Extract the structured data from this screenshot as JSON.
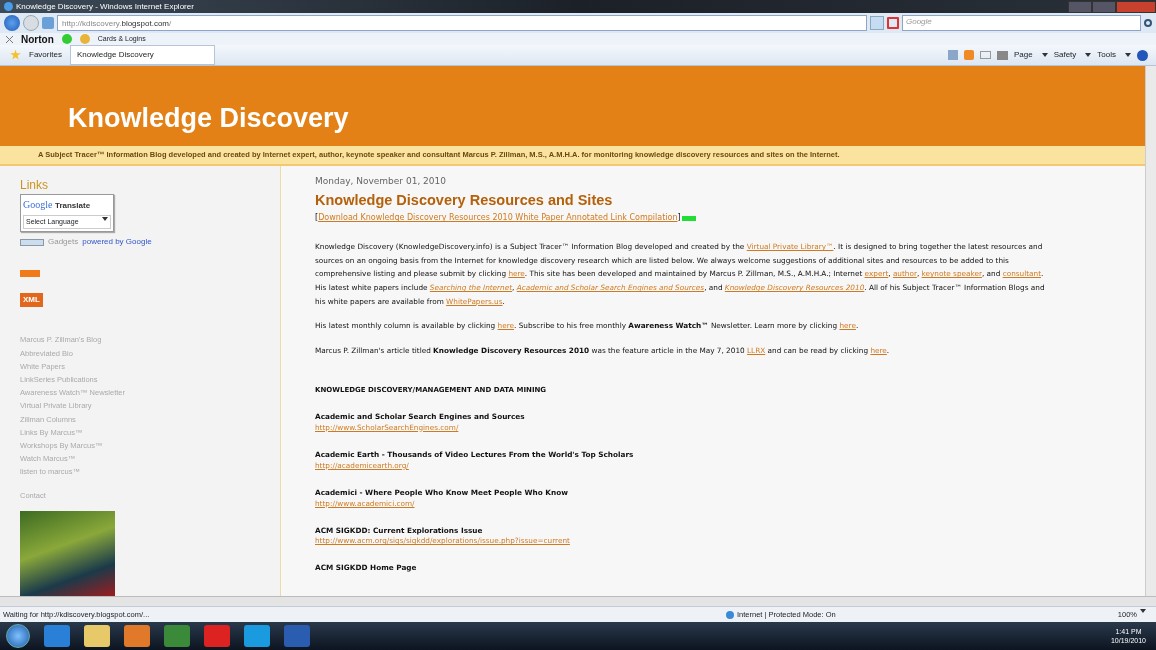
{
  "window": {
    "title": "Knowledge Discovery - Windows Internet Explorer"
  },
  "address_bar": {
    "url": "http://kdiscovery.**blogspot.com**/",
    "search_placeholder": "Google"
  },
  "norton_toolbar": {
    "brand": "Norton",
    "cards_label": "Cards & Logins"
  },
  "favorites_bar": {
    "favorites": "Favorites",
    "tabs": [
      {
        "label": "Knowledge Discovery",
        "selected": true
      }
    ],
    "commands": [
      "Page",
      "Safety",
      "Tools"
    ]
  },
  "blog": {
    "title": "Knowledge Discovery",
    "description": "A Subject Tracer™ Information Blog developed and created by Internet expert, author, keynote speaker and consultant Marcus P. Zillman, M.S., A.M.H.A. for monitoring knowledge discovery resources and sites on the Internet."
  },
  "sidebar": {
    "heading": "Links",
    "translate": {
      "logo": "Google",
      "label": "Translate",
      "select": "Select Language",
      "gadgets": "Gadgets",
      "powered": "powered by Google"
    },
    "xml_badge": "XML",
    "links": [
      "Marcus P. Zillman's Blog",
      "Abbreviated Bio",
      "White Papers",
      "LinkSeries Publications",
      "Awareness Watch™ Newsletter",
      "Virtual Private Library",
      "Zillman Columns",
      "Links By Marcus™",
      "Workshops By Marcus™",
      "Watch Marcus™",
      "listen to marcus™"
    ],
    "contact": "Contact"
  },
  "post": {
    "date": "Monday, November 01, 2010",
    "title": "Knowledge Discovery Resources and Sites",
    "download": [
      {
        "kind": "text",
        "text": "["
      },
      {
        "kind": "link",
        "text": "Download Knowledge Discovery Resources 2010 White Paper Annotated Link Compilation"
      },
      {
        "kind": "text",
        "text": "]"
      }
    ],
    "paragraphs": [
      [
        {
          "kind": "text",
          "text": "Knowledge Discovery (KnowledgeDiscovery.info) is a Subject Tracer™ Information Blog developed and created by the "
        },
        {
          "kind": "link",
          "text": "Virtual Private Library™"
        },
        {
          "kind": "text",
          "text": ". It is designed to bring together the latest resources and sources on an ongoing basis from the Internet for knowledge discovery research which are listed below. We always welcome suggestions of additional sites and resources to be added to this comprehensive listing and please submit by clicking "
        },
        {
          "kind": "link",
          "text": "here"
        },
        {
          "kind": "text",
          "text": ". This site has been developed and maintained by Marcus P. Zillman, M.S., A.M.H.A.; Internet "
        },
        {
          "kind": "link",
          "text": "expert"
        },
        {
          "kind": "text",
          "text": ", "
        },
        {
          "kind": "link",
          "text": "author"
        },
        {
          "kind": "text",
          "text": ", "
        },
        {
          "kind": "link",
          "text": "keynote speaker"
        },
        {
          "kind": "text",
          "text": ", and "
        },
        {
          "kind": "link",
          "text": "consultant"
        },
        {
          "kind": "text",
          "text": ". His latest white papers include "
        },
        {
          "kind": "italic_link",
          "text": "Searching the Internet"
        },
        {
          "kind": "text",
          "text": ", "
        },
        {
          "kind": "italic_link",
          "text": "Academic and Scholar Search Engines and Sources"
        },
        {
          "kind": "text",
          "text": ", and "
        },
        {
          "kind": "italic_link",
          "text": "Knowledge Discovery Resources 2010"
        },
        {
          "kind": "text",
          "text": ". All of his Subject Tracer™ Information Blogs and his white papers are available from "
        },
        {
          "kind": "link",
          "text": "WhitePapers.us"
        },
        {
          "kind": "text",
          "text": "."
        }
      ],
      [
        {
          "kind": "text",
          "text": "His latest monthly column is available by clicking "
        },
        {
          "kind": "link",
          "text": "here"
        },
        {
          "kind": "text",
          "text": ". Subscribe to his free monthly "
        },
        {
          "kind": "bold",
          "text": "Awareness Watch™"
        },
        {
          "kind": "text",
          "text": " Newsletter. Learn more by clicking "
        },
        {
          "kind": "link",
          "text": "here"
        },
        {
          "kind": "text",
          "text": "."
        }
      ],
      [
        {
          "kind": "text",
          "text": "Marcus P. Zillman's article titled "
        },
        {
          "kind": "bold",
          "text": "Knowledge Discovery Resources 2010"
        },
        {
          "kind": "text",
          "text": " was the feature article in the May 7, 2010 "
        },
        {
          "kind": "link",
          "text": "LLRX"
        },
        {
          "kind": "text",
          "text": " and can be read by clicking "
        },
        {
          "kind": "link",
          "text": "here"
        },
        {
          "kind": "text",
          "text": "."
        }
      ]
    ],
    "section_heading": "KNOWLEDGE DISCOVERY/MANAGEMENT AND DATA MINING",
    "entries": [
      {
        "name": "Academic and Scholar Search Engines and Sources",
        "url": "http://www.ScholarSearchEngines.com/"
      },
      {
        "name": "Academic Earth - Thousands of Video Lectures From the World's Top Scholars",
        "url": "http://academicearth.org/"
      },
      {
        "name": "Academici - Where People Who Know Meet People Who Know",
        "url": "http://www.academici.com/"
      },
      {
        "name": "ACM SIGKDD: Current Explorations Issue",
        "url": "http://www.acm.org/sigs/sigkdd/explorations/issue.php?issue=current"
      },
      {
        "name": "ACM SIGKDD Home Page"
      }
    ]
  },
  "status_bar": {
    "message": "Waiting for http://kdiscovery.blogspot.com/...",
    "zone": "Internet | Protected Mode: On",
    "zoom": "100%"
  },
  "taskbar": {
    "time": "1:41 PM",
    "date": "10/19/2010"
  }
}
